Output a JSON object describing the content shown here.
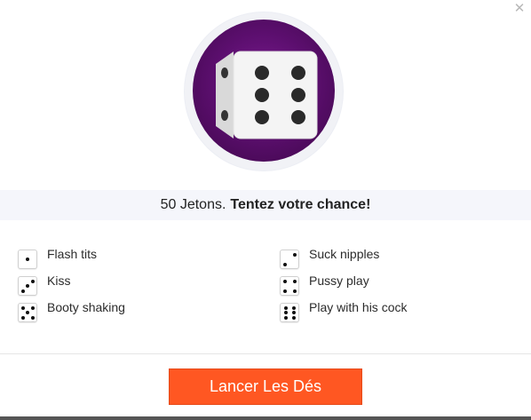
{
  "close_icon": "close-icon",
  "banner": {
    "prefix": "50 Jetons.",
    "cta": "Tentez votre chance!"
  },
  "options": [
    {
      "face": 1,
      "label": "Flash tits"
    },
    {
      "face": 2,
      "label": "Suck nipples"
    },
    {
      "face": 3,
      "label": "Kiss"
    },
    {
      "face": 4,
      "label": "Pussy play"
    },
    {
      "face": 5,
      "label": "Booty shaking"
    },
    {
      "face": 6,
      "label": "Play with his cock"
    }
  ],
  "roll_button": {
    "label": "Lancer Les Dés"
  },
  "colors": {
    "accent": "#ff5722",
    "hero_bg": "#5d0f70",
    "band_bg": "#f5f6fb"
  }
}
